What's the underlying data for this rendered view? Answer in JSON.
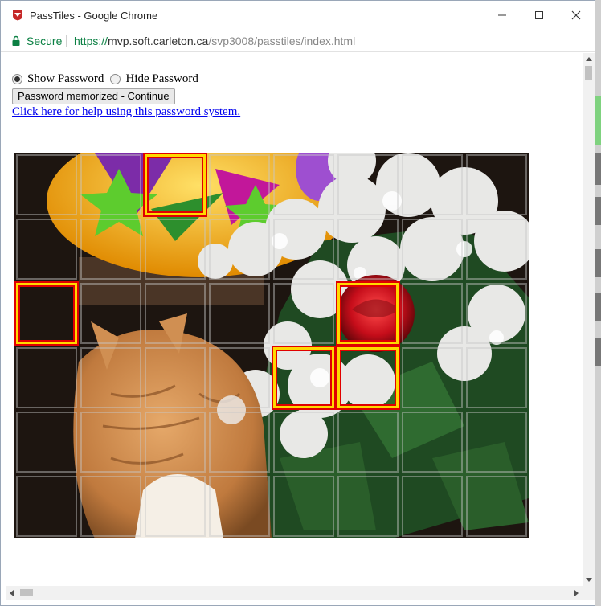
{
  "window": {
    "title": "PassTiles - Google Chrome"
  },
  "address": {
    "secure_label": "Secure",
    "url_scheme": "https://",
    "url_host": "mvp.soft.carleton.ca",
    "url_path": "/svp3008/passtiles/index.html"
  },
  "controls": {
    "show_password_label": "Show Password",
    "hide_password_label": "Hide Password",
    "selected_option": "Show Password",
    "continue_button_label": "Password memorized - Continue",
    "help_link_text": "Click here for help using this password system."
  },
  "password_grid": {
    "columns": 8,
    "rows": 6,
    "selected_tiles": [
      {
        "row": 1,
        "col": 3
      },
      {
        "row": 3,
        "col": 1
      },
      {
        "row": 3,
        "col": 6
      },
      {
        "row": 4,
        "col": 5
      },
      {
        "row": 4,
        "col": 6
      }
    ],
    "colors": {
      "selected_outer": "#ffd900",
      "selected_inner": "#e00000",
      "grid_line": "#c8c8c8"
    }
  },
  "icons": {
    "app": "chrome-app-icon",
    "lock": "lock-icon",
    "minimize": "minimize-icon",
    "maximize": "maximize-icon",
    "close": "close-icon"
  }
}
